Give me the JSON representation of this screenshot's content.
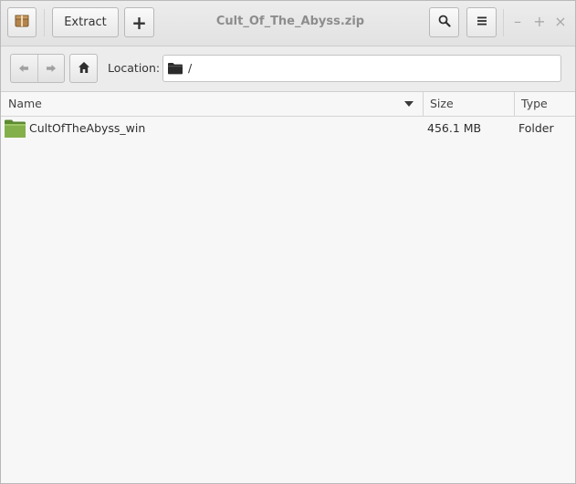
{
  "window": {
    "title": "Cult_Of_The_Abyss.zip"
  },
  "toolbar": {
    "extract_label": "Extract",
    "add_label": "+",
    "app_icon": "archive-package-icon",
    "search_icon": "search-icon",
    "menu_icon": "hamburger-menu-icon",
    "minimize_label": "–",
    "maximize_label": "+",
    "close_label": "×"
  },
  "location": {
    "label": "Location:",
    "path": "/",
    "folder_icon": "folder-icon"
  },
  "columns": {
    "name": "Name",
    "size": "Size",
    "type": "Type"
  },
  "files": [
    {
      "name": "CultOfTheAbyss_win",
      "size": "456.1 MB",
      "type": "Folder",
      "icon": "green-folder-icon"
    }
  ],
  "colors": {
    "folder_green": "#7fab4a",
    "title_gray": "#8d8d8d"
  }
}
